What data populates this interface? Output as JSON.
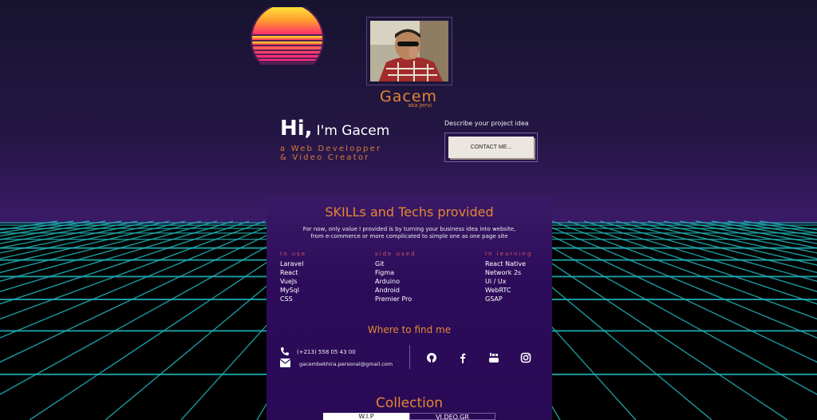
{
  "profile": {
    "name": "Gacem",
    "aka": "aka Jervi",
    "hi": "Hi,",
    "intro": "I'm Gacem",
    "role_line1": "a Web Developper",
    "role_line2": "& Video Creator"
  },
  "contact": {
    "prompt": "Describe your project idea",
    "button_label": "CONTACT ME..."
  },
  "skills": {
    "title": "SKILLs and Techs provided",
    "desc_line1": "For now, only value I provided is by turning your business idea into website,",
    "desc_line2": "from e-commerce or more complicated to simple one as one page site",
    "columns": [
      {
        "heading": "In use",
        "items": [
          "Laravel",
          "React",
          "VueJs",
          "MySql",
          "CSS"
        ]
      },
      {
        "heading": "side used",
        "items": [
          "Git",
          "Figma",
          "Arduino",
          "Android",
          "Premier Pro"
        ]
      },
      {
        "heading": "In learning",
        "items": [
          "React Native",
          "Network 2s",
          "Ui / Ux",
          "WebRTC",
          "GSAP"
        ]
      }
    ]
  },
  "find": {
    "title": "Where to find me",
    "phone": "(+213) 558 05 43 00",
    "email": "gacembekhira.personal@gmail.com"
  },
  "collection": {
    "title": "Collection",
    "tabs": [
      "W.I.P",
      "VI.DEO.GR"
    ]
  },
  "colors": {
    "accent": "#e48634",
    "grid_line": "#22b3b8",
    "panel": "#2a0a55"
  }
}
